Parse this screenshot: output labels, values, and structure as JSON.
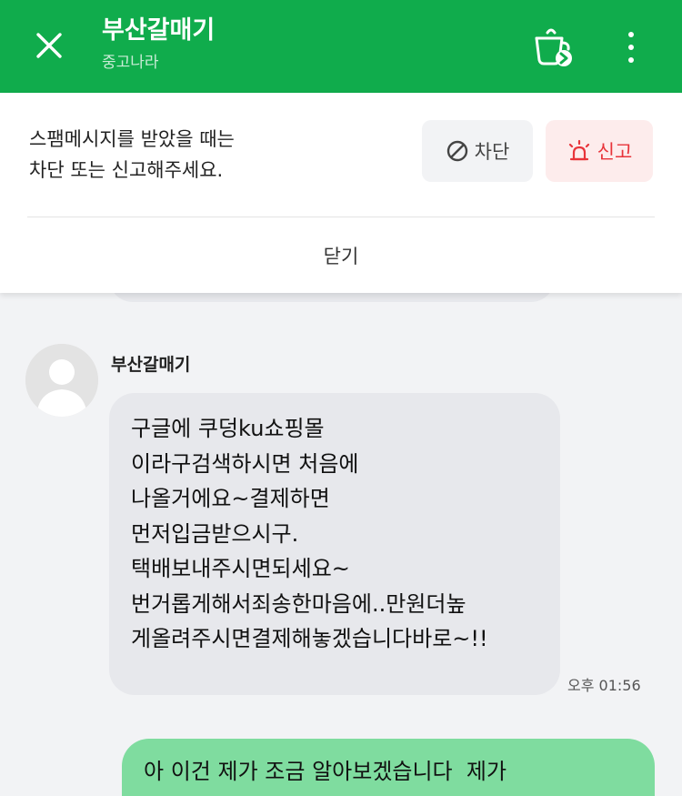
{
  "header": {
    "title": "부산갈매기",
    "subtitle": "중고나라",
    "close_icon": "close-icon",
    "mug_icon": "mug-arrow-icon",
    "more_icon": "more-vertical-icon",
    "colors": {
      "background": "#10ac4c"
    }
  },
  "notice": {
    "text_line1": "스팸메시지를 받았을 때는",
    "text_line2": "차단 또는 신고해주세요.",
    "block_label": "차단",
    "report_label": "신고",
    "close_label": "닫기",
    "colors": {
      "report": "#e8343a"
    }
  },
  "messages": {
    "incoming": {
      "sender": "부산갈매기",
      "lines": [
        "구글에 쿠덩ku쇼핑몰",
        "이라구검색하시면 처음에",
        "나올거에요~결제하면",
        "먼저입금받으시구.",
        "택배보내주시면되세요~",
        "번거롭게해서죄송한마음에..만원더높",
        "게올려주시면결제해놓겠습니다바로~!!"
      ],
      "time": "오후 01:56"
    },
    "outgoing": {
      "text": "아 이건 제가 조금 알아보겠습니다  제가"
    }
  }
}
